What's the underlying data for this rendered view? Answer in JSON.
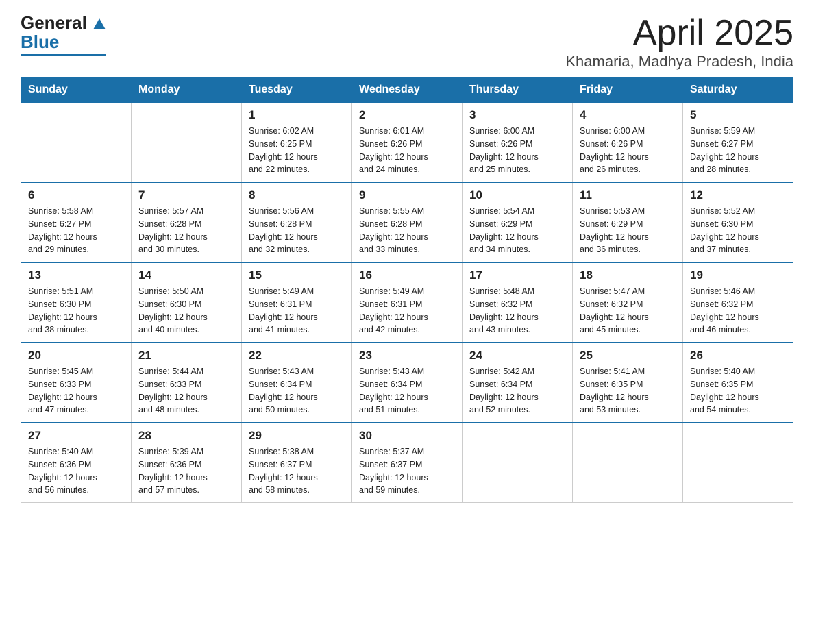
{
  "header": {
    "logo_text_black": "General",
    "logo_text_blue": "Blue",
    "title": "April 2025",
    "subtitle": "Khamaria, Madhya Pradesh, India"
  },
  "days_of_week": [
    "Sunday",
    "Monday",
    "Tuesday",
    "Wednesday",
    "Thursday",
    "Friday",
    "Saturday"
  ],
  "weeks": [
    [
      {
        "day": "",
        "info": ""
      },
      {
        "day": "",
        "info": ""
      },
      {
        "day": "1",
        "info": "Sunrise: 6:02 AM\nSunset: 6:25 PM\nDaylight: 12 hours\nand 22 minutes."
      },
      {
        "day": "2",
        "info": "Sunrise: 6:01 AM\nSunset: 6:26 PM\nDaylight: 12 hours\nand 24 minutes."
      },
      {
        "day": "3",
        "info": "Sunrise: 6:00 AM\nSunset: 6:26 PM\nDaylight: 12 hours\nand 25 minutes."
      },
      {
        "day": "4",
        "info": "Sunrise: 6:00 AM\nSunset: 6:26 PM\nDaylight: 12 hours\nand 26 minutes."
      },
      {
        "day": "5",
        "info": "Sunrise: 5:59 AM\nSunset: 6:27 PM\nDaylight: 12 hours\nand 28 minutes."
      }
    ],
    [
      {
        "day": "6",
        "info": "Sunrise: 5:58 AM\nSunset: 6:27 PM\nDaylight: 12 hours\nand 29 minutes."
      },
      {
        "day": "7",
        "info": "Sunrise: 5:57 AM\nSunset: 6:28 PM\nDaylight: 12 hours\nand 30 minutes."
      },
      {
        "day": "8",
        "info": "Sunrise: 5:56 AM\nSunset: 6:28 PM\nDaylight: 12 hours\nand 32 minutes."
      },
      {
        "day": "9",
        "info": "Sunrise: 5:55 AM\nSunset: 6:28 PM\nDaylight: 12 hours\nand 33 minutes."
      },
      {
        "day": "10",
        "info": "Sunrise: 5:54 AM\nSunset: 6:29 PM\nDaylight: 12 hours\nand 34 minutes."
      },
      {
        "day": "11",
        "info": "Sunrise: 5:53 AM\nSunset: 6:29 PM\nDaylight: 12 hours\nand 36 minutes."
      },
      {
        "day": "12",
        "info": "Sunrise: 5:52 AM\nSunset: 6:30 PM\nDaylight: 12 hours\nand 37 minutes."
      }
    ],
    [
      {
        "day": "13",
        "info": "Sunrise: 5:51 AM\nSunset: 6:30 PM\nDaylight: 12 hours\nand 38 minutes."
      },
      {
        "day": "14",
        "info": "Sunrise: 5:50 AM\nSunset: 6:30 PM\nDaylight: 12 hours\nand 40 minutes."
      },
      {
        "day": "15",
        "info": "Sunrise: 5:49 AM\nSunset: 6:31 PM\nDaylight: 12 hours\nand 41 minutes."
      },
      {
        "day": "16",
        "info": "Sunrise: 5:49 AM\nSunset: 6:31 PM\nDaylight: 12 hours\nand 42 minutes."
      },
      {
        "day": "17",
        "info": "Sunrise: 5:48 AM\nSunset: 6:32 PM\nDaylight: 12 hours\nand 43 minutes."
      },
      {
        "day": "18",
        "info": "Sunrise: 5:47 AM\nSunset: 6:32 PM\nDaylight: 12 hours\nand 45 minutes."
      },
      {
        "day": "19",
        "info": "Sunrise: 5:46 AM\nSunset: 6:32 PM\nDaylight: 12 hours\nand 46 minutes."
      }
    ],
    [
      {
        "day": "20",
        "info": "Sunrise: 5:45 AM\nSunset: 6:33 PM\nDaylight: 12 hours\nand 47 minutes."
      },
      {
        "day": "21",
        "info": "Sunrise: 5:44 AM\nSunset: 6:33 PM\nDaylight: 12 hours\nand 48 minutes."
      },
      {
        "day": "22",
        "info": "Sunrise: 5:43 AM\nSunset: 6:34 PM\nDaylight: 12 hours\nand 50 minutes."
      },
      {
        "day": "23",
        "info": "Sunrise: 5:43 AM\nSunset: 6:34 PM\nDaylight: 12 hours\nand 51 minutes."
      },
      {
        "day": "24",
        "info": "Sunrise: 5:42 AM\nSunset: 6:34 PM\nDaylight: 12 hours\nand 52 minutes."
      },
      {
        "day": "25",
        "info": "Sunrise: 5:41 AM\nSunset: 6:35 PM\nDaylight: 12 hours\nand 53 minutes."
      },
      {
        "day": "26",
        "info": "Sunrise: 5:40 AM\nSunset: 6:35 PM\nDaylight: 12 hours\nand 54 minutes."
      }
    ],
    [
      {
        "day": "27",
        "info": "Sunrise: 5:40 AM\nSunset: 6:36 PM\nDaylight: 12 hours\nand 56 minutes."
      },
      {
        "day": "28",
        "info": "Sunrise: 5:39 AM\nSunset: 6:36 PM\nDaylight: 12 hours\nand 57 minutes."
      },
      {
        "day": "29",
        "info": "Sunrise: 5:38 AM\nSunset: 6:37 PM\nDaylight: 12 hours\nand 58 minutes."
      },
      {
        "day": "30",
        "info": "Sunrise: 5:37 AM\nSunset: 6:37 PM\nDaylight: 12 hours\nand 59 minutes."
      },
      {
        "day": "",
        "info": ""
      },
      {
        "day": "",
        "info": ""
      },
      {
        "day": "",
        "info": ""
      }
    ]
  ]
}
